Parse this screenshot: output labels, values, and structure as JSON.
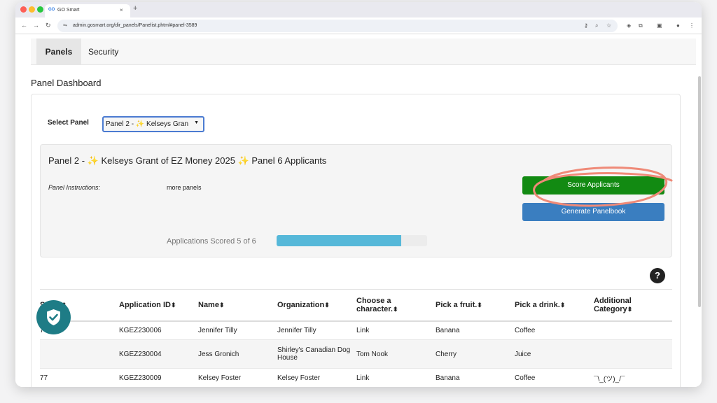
{
  "browser": {
    "tab_title": "GO Smart",
    "tab_favicon": "GO",
    "tab_close": "×",
    "new_tab": "+",
    "url": "admin.gosmart.org/dir_panels/Panelist.phtml#panel-3589"
  },
  "nav": {
    "tabs": [
      "Panels",
      "Security"
    ]
  },
  "page_title": "Panel Dashboard",
  "select_panel": {
    "label": "Select Panel",
    "value": "Panel 2 - ✨ Kelseys Gran"
  },
  "panel": {
    "title": "Panel 2 - ✨ Kelseys Grant of EZ Money 2025 ✨ Panel 6 Applicants",
    "instructions_label": "Panel Instructions:",
    "instructions_value": "more panels",
    "score_button": "Score Applicants",
    "panelbook_button": "Generate Panelbook",
    "scored_text": "Applications Scored 5 of 6",
    "scored_fraction": 0.83
  },
  "help_icon": "?",
  "table": {
    "headers": [
      "Score",
      "Application ID",
      "Name",
      "Organization",
      "Choose a character.",
      "Pick a fruit.",
      "Pick a drink.",
      "Additional Category"
    ],
    "rows": [
      [
        "77",
        "KGEZ230006",
        "Jennifer Tilly",
        "Jennifer Tilly",
        "Link",
        "Banana",
        "Coffee",
        ""
      ],
      [
        "",
        "KGEZ230004",
        "Jess Gronich",
        "Shirley's Canadian Dog House",
        "Tom Nook",
        "Cherry",
        "Juice",
        ""
      ],
      [
        "77",
        "KGEZ230009",
        "Kelsey Foster",
        "Kelsey Foster",
        "Link",
        "Banana",
        "Coffee",
        "¯\\_(ツ)_/¯"
      ]
    ]
  },
  "colors": {
    "score_button": "#128a12",
    "panelbook_button": "#3a7ec0",
    "progress_fill": "#56b8d9",
    "annotation_circle": "#ef8a78",
    "shield_badge": "#1e7c86"
  }
}
